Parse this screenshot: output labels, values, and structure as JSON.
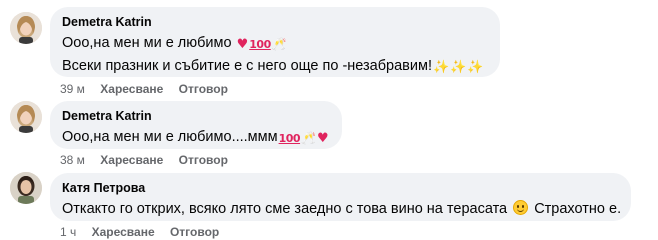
{
  "comments": [
    {
      "author": "Demetra Katrin",
      "lines": [
        "Ооо,на мен ми е любимо",
        "Всеки празник и събитие е с него още по -незабравим!"
      ],
      "time": "39 м",
      "like": "Харесване",
      "reply": "Отговор"
    },
    {
      "author": "Demetra Katrin",
      "lines": [
        "Ооо,на мен ми е любимо....ммм"
      ],
      "time": "38 м",
      "like": "Харесване",
      "reply": "Отговор"
    },
    {
      "author": "Катя Петрова",
      "lines": [
        "Откакто го открих, всяко лято сме заедно с това вино на терасата",
        "Страхотно е."
      ],
      "time": "1 ч",
      "like": "Харесване",
      "reply": "Отговор"
    }
  ],
  "icons": {
    "heart": "heart-icon",
    "hundred": "hundred-points-icon",
    "glasses": "clinking-glasses-icon",
    "sparkles": "sparkles-icon",
    "smiley": "smiling-face-icon"
  },
  "colors": {
    "bubble": "#f0f2f5",
    "meta": "#65676b",
    "text": "#050505",
    "heart": "#e0245e"
  }
}
